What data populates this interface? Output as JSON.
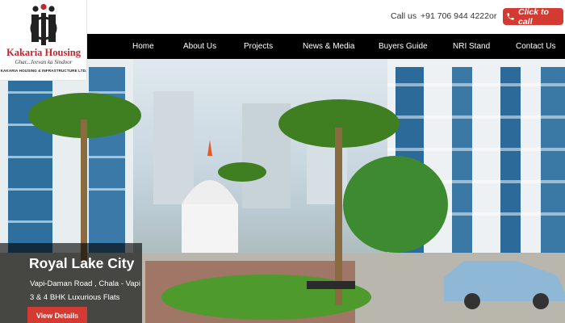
{
  "brand": {
    "name": "Kakaria Housing",
    "tagline": "Ghar...Jeevan ka Sindoor",
    "company": "KAKARIA HOUSING & INFRASTRUCTURE LTD.",
    "logo_color": "#c1272d"
  },
  "contact": {
    "call_label": "Call us",
    "phone": "+91 706 944 4222",
    "or_label": "or",
    "click_to_call": "Click to call",
    "button_color": "#d33a32"
  },
  "nav": {
    "items": [
      {
        "label": "Home"
      },
      {
        "label": "About Us"
      },
      {
        "label": "Projects"
      },
      {
        "label": "News & Media"
      },
      {
        "label": "Buyers Guide"
      },
      {
        "label": "NRI Stand"
      },
      {
        "label": "Contact Us"
      }
    ]
  },
  "hero": {
    "title": "Royal Lake City",
    "location": "Vapi-Daman Road , Chala - Vapi",
    "configuration": "3 & 4 BHK Luxurious Flats",
    "cta": "View Details"
  }
}
